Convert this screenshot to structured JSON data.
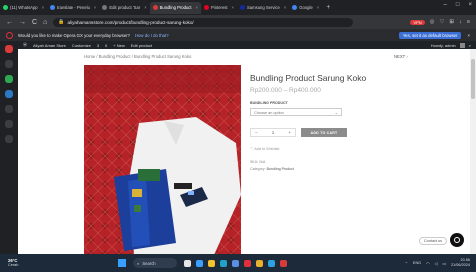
{
  "browser": {
    "tabs": [
      {
        "label": "(11) WhatsApp",
        "color": "#25d366",
        "active": false
      },
      {
        "label": "translate - Penelu",
        "color": "#4285f4",
        "active": false
      },
      {
        "label": "Edit product 'Sar",
        "color": "#777777",
        "active": false
      },
      {
        "label": "Bundling Product",
        "color": "#d93b3b",
        "active": true
      },
      {
        "label": "Pinterest",
        "color": "#e60023",
        "active": false
      },
      {
        "label": "Samsung Service",
        "color": "#1428a0",
        "active": false
      },
      {
        "label": "Google",
        "color": "#4285f4",
        "active": false
      }
    ],
    "new_tab": "+",
    "url": "aliyahamansstore.com/product/bundling-product-sarung-koko/",
    "vpn_label": "VPN",
    "nav": {
      "back": "←",
      "forward": "→",
      "reload": "C",
      "home": "⌂"
    }
  },
  "promo": {
    "text": "Would you like to make Opera GX your everyday browser?",
    "link": "How do I do that?",
    "primary_button": "Yes, set it as default browser",
    "close": "×"
  },
  "admin_bar": {
    "items": [
      "Aliyah Aman Store",
      "Customize",
      "3",
      "0",
      "+ New",
      "Edit product"
    ],
    "right": "Howdy, admin"
  },
  "page": {
    "breadcrumb": "Home / Bundling Product / Bundling Product Sarung Koko",
    "next_label": "NEXT",
    "title": "Bundling Product Sarung Koko",
    "price": "Rp200.000 – Rp400.000",
    "option_label": "BUNDLING PRODUCT",
    "select_placeholder": "Choose an option",
    "qty_minus": "−",
    "qty_value": "1",
    "qty_plus": "+",
    "add_to_cart": "ADD TO CART",
    "wishlist": "Add to Wishlist",
    "sku": "SKU: N/A",
    "category_label": "Category:",
    "category_value": "Bundling Product",
    "contact_us": "Contact us"
  },
  "taskbar": {
    "temp": "26°C",
    "weather": "Cerah",
    "search_label": "Search",
    "time": "20.56",
    "date": "21/06/2024",
    "lang": "ENG"
  }
}
